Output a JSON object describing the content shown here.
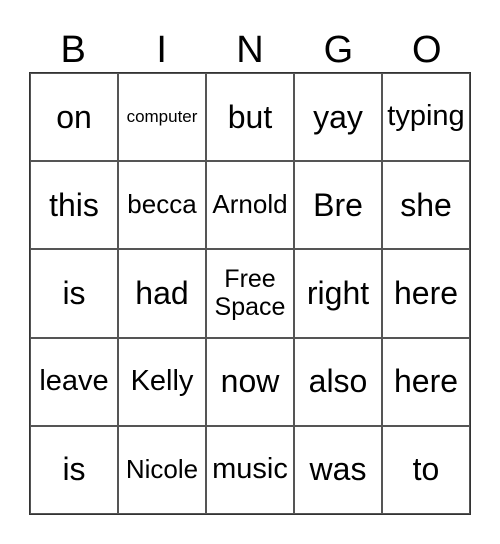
{
  "header": [
    "B",
    "I",
    "N",
    "G",
    "O"
  ],
  "cells": [
    [
      "on",
      "computer",
      "but",
      "yay",
      "typing"
    ],
    [
      "this",
      "becca",
      "Arnold",
      "Bre",
      "she"
    ],
    [
      "is",
      "had",
      "Free Space",
      "right",
      "here"
    ],
    [
      "leave",
      "Kelly",
      "now",
      "also",
      "here"
    ],
    [
      "is",
      "Nicole",
      "music",
      "was",
      "to"
    ]
  ]
}
